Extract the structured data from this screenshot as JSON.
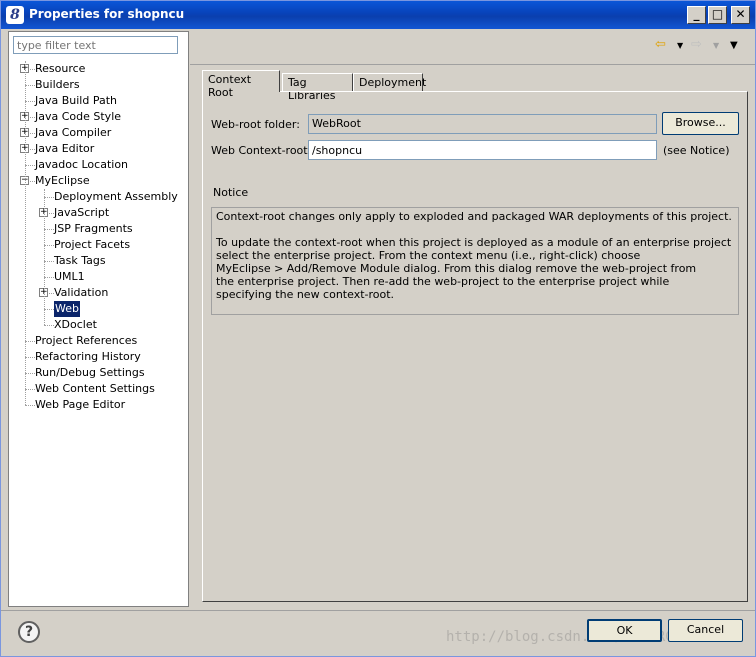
{
  "window": {
    "title": "Properties for shopncu",
    "app_icon": "myeclipse-icon",
    "controls": {
      "minimize": "_",
      "maximize": "□",
      "close": "✕"
    }
  },
  "filter": {
    "placeholder": "type filter text",
    "value": ""
  },
  "tree": {
    "items": [
      {
        "label": "Resource",
        "expandable": true
      },
      {
        "label": "Builders",
        "expandable": false
      },
      {
        "label": "Java Build Path",
        "expandable": false
      },
      {
        "label": "Java Code Style",
        "expandable": true
      },
      {
        "label": "Java Compiler",
        "expandable": true
      },
      {
        "label": "Java Editor",
        "expandable": true
      },
      {
        "label": "Javadoc Location",
        "expandable": false
      },
      {
        "label": "MyEclipse",
        "expandable": true,
        "expanded": true
      },
      {
        "label": "Deployment Assembly",
        "expandable": false,
        "child": true
      },
      {
        "label": "JavaScript",
        "expandable": true,
        "child": true
      },
      {
        "label": "JSP Fragments",
        "expandable": false,
        "child": true
      },
      {
        "label": "Project Facets",
        "expandable": false,
        "child": true
      },
      {
        "label": "Task Tags",
        "expandable": false,
        "child": true
      },
      {
        "label": "UML1",
        "expandable": false,
        "child": true
      },
      {
        "label": "Validation",
        "expandable": true,
        "child": true
      },
      {
        "label": "Web",
        "expandable": false,
        "child": true,
        "selected": true
      },
      {
        "label": "XDoclet",
        "expandable": false,
        "child": true
      },
      {
        "label": "Project References",
        "expandable": false
      },
      {
        "label": "Refactoring History",
        "expandable": false
      },
      {
        "label": "Run/Debug Settings",
        "expandable": false
      },
      {
        "label": "Web Content Settings",
        "expandable": false
      },
      {
        "label": "Web Page Editor",
        "expandable": false
      }
    ]
  },
  "tabs": [
    {
      "label": "Context Root",
      "active": true
    },
    {
      "label": "Tag Libraries",
      "active": false
    },
    {
      "label": "Deployment",
      "active": false
    }
  ],
  "form": {
    "web_root_label": "Web-root folder:",
    "web_root_value": "WebRoot",
    "browse_label": "Browse...",
    "context_root_label": "Web Context-root:",
    "context_root_value": "/shopncu",
    "see_notice": "(see Notice)"
  },
  "notice": {
    "heading": "Notice",
    "para1": "Context-root changes only apply to exploded and packaged WAR deployments of this project.",
    "para2_lines": [
      "To update the context-root when this project is deployed as a module of an enterprise project",
      "select the enterprise project. From the context menu (i.e., right-click) choose",
      "MyEclipse > Add/Remove Module dialog. From this dialog remove the web-project from",
      "the enterprise project. Then re-add the web-project to the enterprise project while",
      "specifying the new context-root."
    ]
  },
  "footer": {
    "ok_label": "OK",
    "cancel_label": "Cancel",
    "help_glyph": "?",
    "watermark": "http://blog.csdn.net/LHBMRC"
  }
}
